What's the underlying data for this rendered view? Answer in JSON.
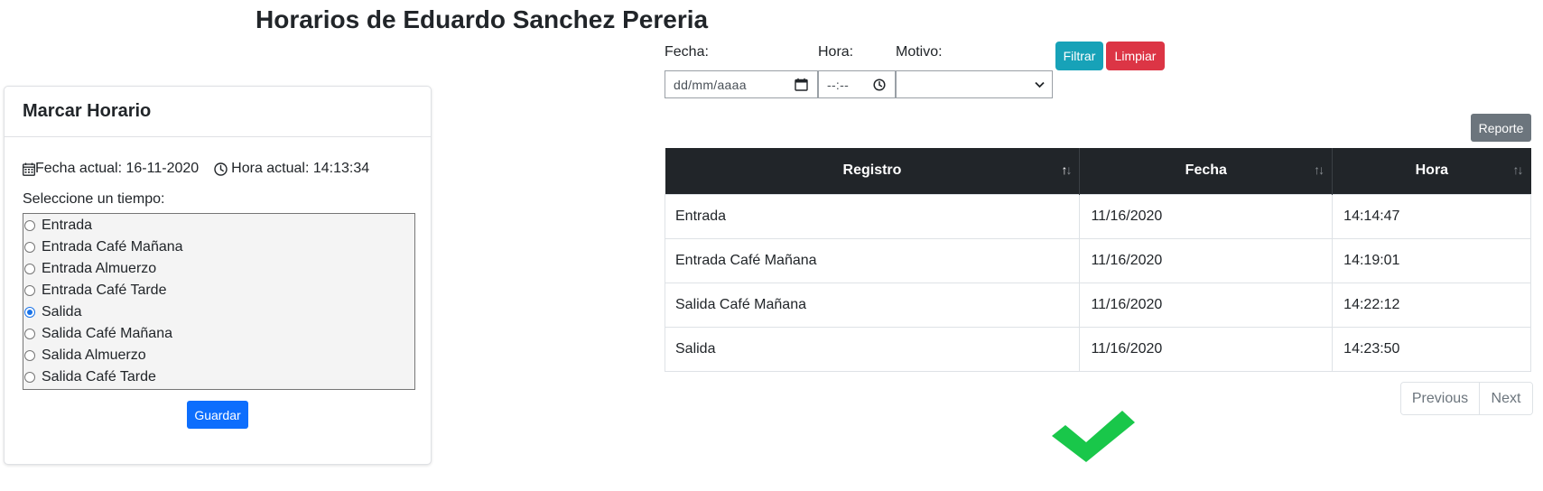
{
  "page": {
    "title": "Horarios de Eduardo Sanchez Pereria"
  },
  "card": {
    "title": "Marcar Horario",
    "date_label": "Fecha actual: 16-11-2020",
    "time_label": "Hora actual: 14:13:34",
    "prompt": "Seleccione un tiempo:",
    "options": [
      {
        "label": "Entrada",
        "checked": false
      },
      {
        "label": "Entrada Café Mañana",
        "checked": false
      },
      {
        "label": "Entrada Almuerzo",
        "checked": false
      },
      {
        "label": "Entrada Café Tarde",
        "checked": false
      },
      {
        "label": "Salida",
        "checked": true
      },
      {
        "label": "Salida Café Mañana",
        "checked": false
      },
      {
        "label": "Salida Almuerzo",
        "checked": false
      },
      {
        "label": "Salida Café Tarde",
        "checked": false
      }
    ],
    "save_label": "Guardar",
    "icons": {
      "date": "calendar-icon",
      "time": "clock-icon"
    }
  },
  "filters": {
    "date_label": "Fecha:",
    "date_placeholder": "dd/mm/aaaa",
    "time_label": "Hora:",
    "time_placeholder": "--:--",
    "reason_label": "Motivo:",
    "reason_value": "",
    "filter_label": "Filtrar",
    "clear_label": "Limpiar"
  },
  "report_label": "Reporte",
  "table": {
    "columns": [
      "Registro",
      "Fecha",
      "Hora"
    ],
    "rows": [
      [
        "Entrada",
        "11/16/2020",
        "14:14:47"
      ],
      [
        "Entrada Café Mañana",
        "11/16/2020",
        "14:19:01"
      ],
      [
        "Salida Café Mañana",
        "11/16/2020",
        "14:22:12"
      ],
      [
        "Salida",
        "11/16/2020",
        "14:23:50"
      ]
    ]
  },
  "pagination": {
    "previous_label": "Previous",
    "next_label": "Next"
  },
  "colors": {
    "filter_button": "#17a2b8",
    "clear_button": "#dc3545",
    "save_button": "#0d6efd",
    "report_button": "#6c757d",
    "table_header": "#212529",
    "check_mark": "#19c74a"
  }
}
